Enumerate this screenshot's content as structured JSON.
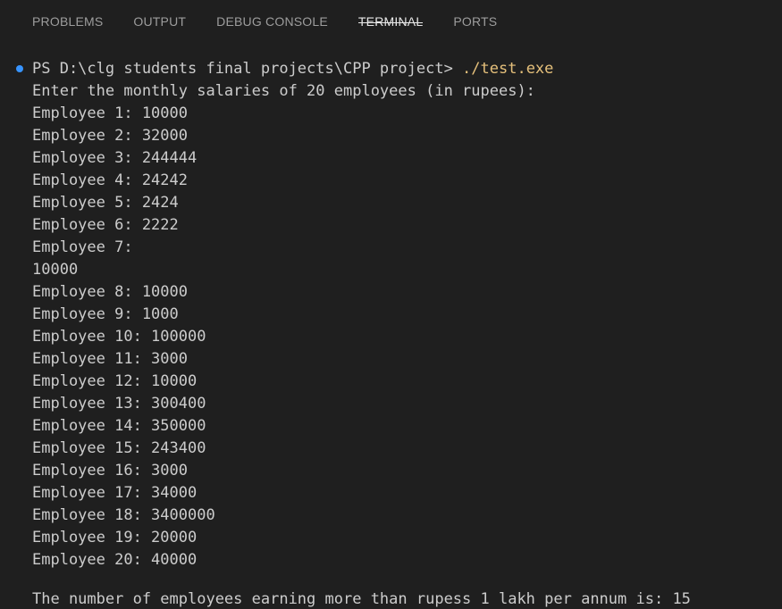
{
  "tabs": [
    {
      "label": "PROBLEMS"
    },
    {
      "label": "OUTPUT"
    },
    {
      "label": "DEBUG CONSOLE"
    },
    {
      "label": "TERMINAL",
      "active": true
    },
    {
      "label": "PORTS"
    }
  ],
  "terminal": {
    "prompt": "PS D:\\clg students final projects\\CPP project> ",
    "command": "./test.exe",
    "intro": "Enter the monthly salaries of 20 employees (in rupees):",
    "lines": [
      "Employee 1: 10000",
      "Employee 2: 32000",
      "Employee 3: 244444",
      "Employee 4: 24242",
      "Employee 5: 2424",
      "Employee 6: 2222",
      "Employee 7:",
      "10000",
      "Employee 8: 10000",
      "Employee 9: 1000",
      "Employee 10: 100000",
      "Employee 11: 3000",
      "Employee 12: 10000",
      "Employee 13: 300400",
      "Employee 14: 350000",
      "Employee 15: 243400",
      "Employee 16: 3000",
      "Employee 17: 34000",
      "Employee 18: 3400000",
      "Employee 19: 20000",
      "Employee 20: 40000"
    ],
    "result": "The number of employees earning more than rupess 1 lakh per annum is: 15"
  },
  "colors": {
    "background": "#1f1f1f",
    "text": "#cccccc",
    "command": "#e5c07b",
    "status_dot": "#3794ff"
  }
}
